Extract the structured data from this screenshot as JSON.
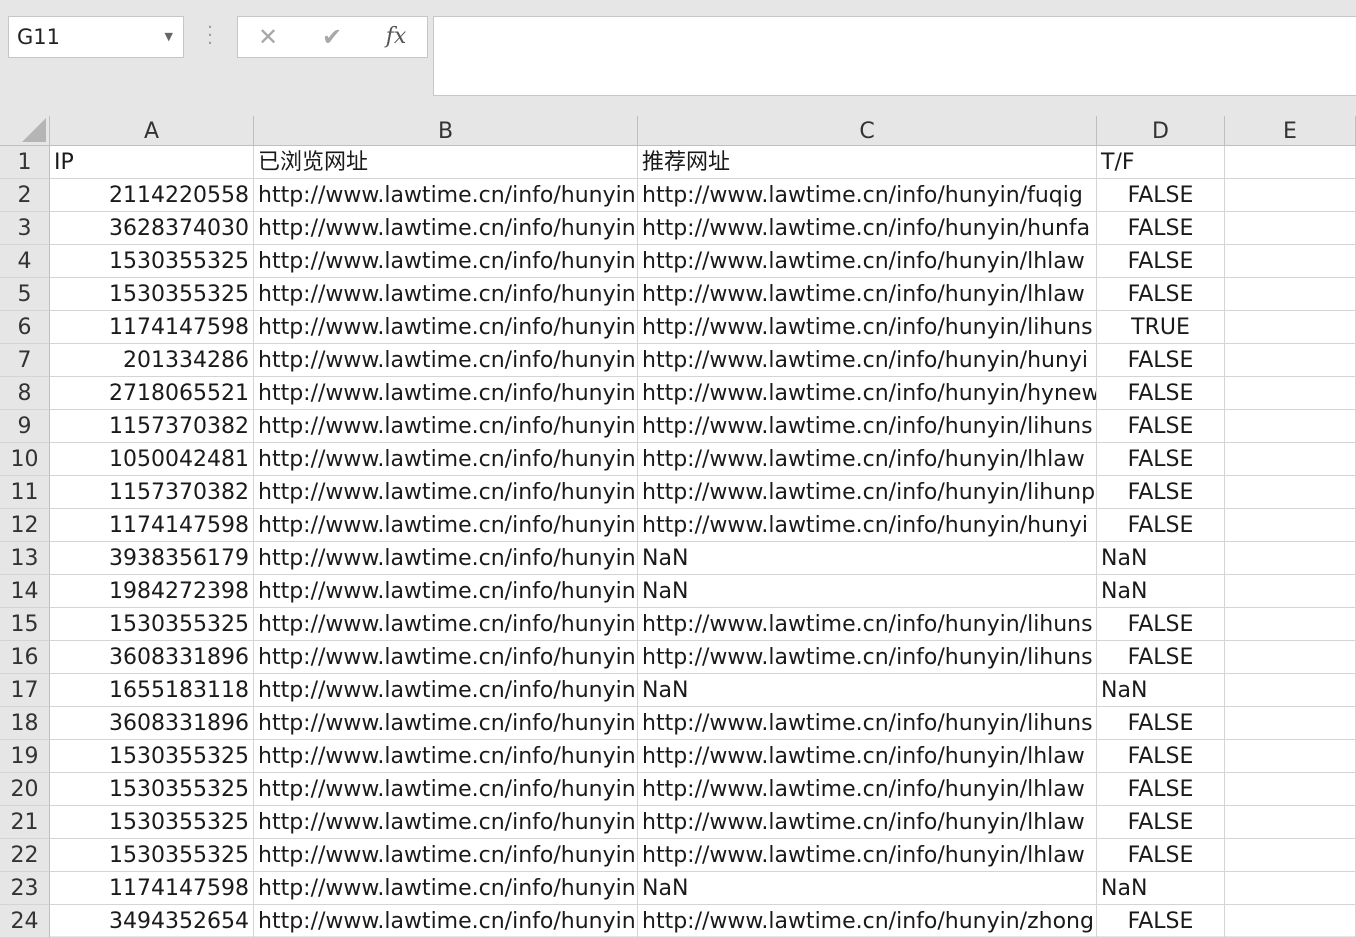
{
  "name_box": {
    "value": "G11"
  },
  "formula_bar": {
    "cancel_glyph": "✕",
    "enter_glyph": "✔",
    "fx_label": "fx",
    "value": ""
  },
  "columns": [
    "A",
    "B",
    "C",
    "D",
    "E"
  ],
  "rows": [
    {
      "num": "1",
      "ip": "IP",
      "viewed": "已浏览网址",
      "recommended": "推荐网址",
      "tf": "T/F"
    },
    {
      "num": "2",
      "ip": "2114220558",
      "viewed": "http://www.lawtime.cn/info/hunyin",
      "recommended": "http://www.lawtime.cn/info/hunyin/fuqig",
      "tf": "FALSE"
    },
    {
      "num": "3",
      "ip": "3628374030",
      "viewed": "http://www.lawtime.cn/info/hunyin",
      "recommended": "http://www.lawtime.cn/info/hunyin/hunfa",
      "tf": "FALSE"
    },
    {
      "num": "4",
      "ip": "1530355325",
      "viewed": "http://www.lawtime.cn/info/hunyin",
      "recommended": "http://www.lawtime.cn/info/hunyin/lhlaw",
      "tf": "FALSE"
    },
    {
      "num": "5",
      "ip": "1530355325",
      "viewed": "http://www.lawtime.cn/info/hunyin",
      "recommended": "http://www.lawtime.cn/info/hunyin/lhlaw",
      "tf": "FALSE"
    },
    {
      "num": "6",
      "ip": "1174147598",
      "viewed": "http://www.lawtime.cn/info/hunyin",
      "recommended": "http://www.lawtime.cn/info/hunyin/lihuns",
      "tf": "TRUE"
    },
    {
      "num": "7",
      "ip": "201334286",
      "viewed": "http://www.lawtime.cn/info/hunyin",
      "recommended": "http://www.lawtime.cn/info/hunyin/hunyi",
      "tf": "FALSE"
    },
    {
      "num": "8",
      "ip": "2718065521",
      "viewed": "http://www.lawtime.cn/info/hunyin",
      "recommended": "http://www.lawtime.cn/info/hunyin/hynew",
      "tf": "FALSE"
    },
    {
      "num": "9",
      "ip": "1157370382",
      "viewed": "http://www.lawtime.cn/info/hunyin",
      "recommended": "http://www.lawtime.cn/info/hunyin/lihuns",
      "tf": "FALSE"
    },
    {
      "num": "10",
      "ip": "1050042481",
      "viewed": "http://www.lawtime.cn/info/hunyin",
      "recommended": "http://www.lawtime.cn/info/hunyin/lhlaw",
      "tf": "FALSE"
    },
    {
      "num": "11",
      "ip": "1157370382",
      "viewed": "http://www.lawtime.cn/info/hunyin",
      "recommended": "http://www.lawtime.cn/info/hunyin/lihunp",
      "tf": "FALSE"
    },
    {
      "num": "12",
      "ip": "1174147598",
      "viewed": "http://www.lawtime.cn/info/hunyin",
      "recommended": "http://www.lawtime.cn/info/hunyin/hunyi",
      "tf": "FALSE"
    },
    {
      "num": "13",
      "ip": "3938356179",
      "viewed": "http://www.lawtime.cn/info/hunyin",
      "recommended": "NaN",
      "tf": "NaN"
    },
    {
      "num": "14",
      "ip": "1984272398",
      "viewed": "http://www.lawtime.cn/info/hunyin",
      "recommended": "NaN",
      "tf": "NaN"
    },
    {
      "num": "15",
      "ip": "1530355325",
      "viewed": "http://www.lawtime.cn/info/hunyin",
      "recommended": "http://www.lawtime.cn/info/hunyin/lihuns",
      "tf": "FALSE"
    },
    {
      "num": "16",
      "ip": "3608331896",
      "viewed": "http://www.lawtime.cn/info/hunyin",
      "recommended": "http://www.lawtime.cn/info/hunyin/lihuns",
      "tf": "FALSE"
    },
    {
      "num": "17",
      "ip": "1655183118",
      "viewed": "http://www.lawtime.cn/info/hunyin",
      "recommended": "NaN",
      "tf": "NaN"
    },
    {
      "num": "18",
      "ip": "3608331896",
      "viewed": "http://www.lawtime.cn/info/hunyin",
      "recommended": "http://www.lawtime.cn/info/hunyin/lihuns",
      "tf": "FALSE"
    },
    {
      "num": "19",
      "ip": "1530355325",
      "viewed": "http://www.lawtime.cn/info/hunyin",
      "recommended": "http://www.lawtime.cn/info/hunyin/lhlaw",
      "tf": "FALSE"
    },
    {
      "num": "20",
      "ip": "1530355325",
      "viewed": "http://www.lawtime.cn/info/hunyin",
      "recommended": "http://www.lawtime.cn/info/hunyin/lhlaw",
      "tf": "FALSE"
    },
    {
      "num": "21",
      "ip": "1530355325",
      "viewed": "http://www.lawtime.cn/info/hunyin",
      "recommended": "http://www.lawtime.cn/info/hunyin/lhlaw",
      "tf": "FALSE"
    },
    {
      "num": "22",
      "ip": "1530355325",
      "viewed": "http://www.lawtime.cn/info/hunyin",
      "recommended": "http://www.lawtime.cn/info/hunyin/lhlaw",
      "tf": "FALSE"
    },
    {
      "num": "23",
      "ip": "1174147598",
      "viewed": "http://www.lawtime.cn/info/hunyin",
      "recommended": "NaN",
      "tf": "NaN"
    },
    {
      "num": "24",
      "ip": "3494352654",
      "viewed": "http://www.lawtime.cn/info/hunyin",
      "recommended": "http://www.lawtime.cn/info/hunyin/zhong",
      "tf": "FALSE"
    }
  ]
}
